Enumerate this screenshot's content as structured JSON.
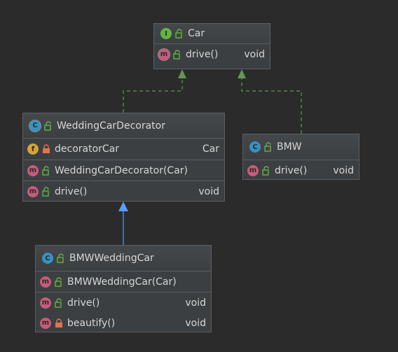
{
  "diagram": {
    "classes": {
      "car": {
        "kind_letter": "I",
        "name": "Car",
        "methods": [
          {
            "letter": "m",
            "name": "drive()",
            "type": "void"
          }
        ]
      },
      "wedding_car_decorator": {
        "kind_letter": "C",
        "name": "WeddingCarDecorator",
        "fields": [
          {
            "letter": "f",
            "name": "decoratorCar",
            "type": "Car"
          }
        ],
        "constructors": [
          {
            "letter": "m",
            "name": "WeddingCarDecorator(Car)"
          }
        ],
        "methods": [
          {
            "letter": "m",
            "name": "drive()",
            "type": "void"
          }
        ]
      },
      "bmw": {
        "kind_letter": "C",
        "name": "BMW",
        "methods": [
          {
            "letter": "m",
            "name": "drive()",
            "type": "void"
          }
        ]
      },
      "bmw_wedding_car": {
        "kind_letter": "C",
        "name": "BMWWeddingCar",
        "constructors": [
          {
            "letter": "m",
            "name": "BMWWeddingCar(Car)"
          }
        ],
        "methods": [
          {
            "letter": "m",
            "name": "drive()",
            "type": "void"
          },
          {
            "letter": "m",
            "name": "beautify()",
            "type": "void"
          }
        ]
      }
    },
    "colors": {
      "background": "#2b2b2b",
      "box": "#3c3f41",
      "realization_edge": "#629755",
      "generalization_edge": "#589df6",
      "public_lock": "#62b543",
      "private_lock": "#e0744e"
    }
  }
}
